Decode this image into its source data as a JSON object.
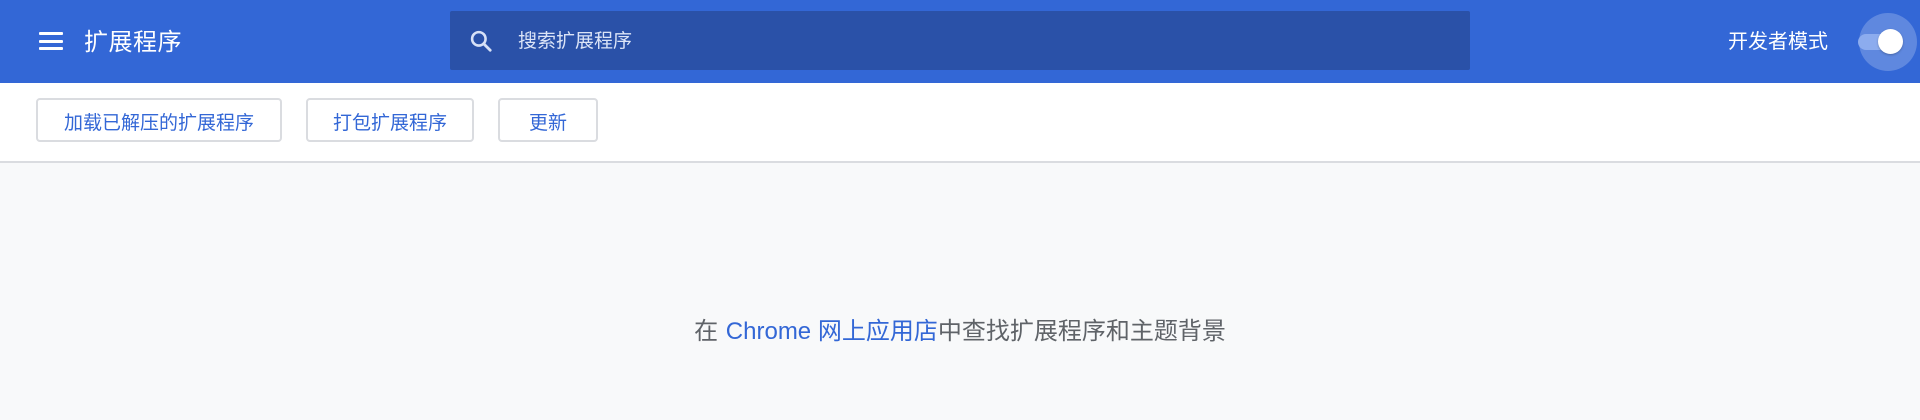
{
  "header": {
    "menu_icon": "hamburger-menu-icon",
    "title": "扩展程序",
    "search": {
      "icon": "search-icon",
      "placeholder": "搜索扩展程序",
      "value": ""
    },
    "dev_mode": {
      "label": "开发者模式",
      "enabled": true
    }
  },
  "toolbar": {
    "load_unpacked_label": "加载已解压的扩展程序",
    "pack_label": "打包扩展程序",
    "update_label": "更新"
  },
  "main": {
    "empty_prefix": "在 ",
    "store_link_text": "Chrome 网上应用店",
    "empty_suffix": "中查找扩展程序和主题背景"
  },
  "colors": {
    "header_bg": "#3367d6",
    "search_bg": "#2a51a8",
    "accent": "#3367d6",
    "page_bg": "#f8f9fa",
    "muted_text": "#5f6368"
  }
}
